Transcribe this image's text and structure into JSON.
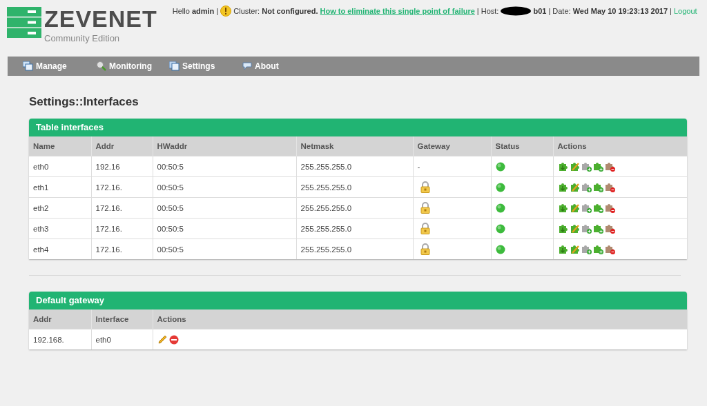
{
  "logo": {
    "name": "ZEVENET",
    "edition": "Community Edition"
  },
  "topbar": {
    "greeting": "Hello **admin** |",
    "cluster": "Cluster: **Not configured.**",
    "cluster_link": "How to eliminate this single point of failure",
    "host_label": "| Host:",
    "host": "b01",
    "date": "| Date: **Wed May 10 19:23:13 2017** |",
    "logout": "Logout"
  },
  "nav": [
    {
      "label": "Manage"
    },
    {
      "label": "Monitoring"
    },
    {
      "label": "Settings"
    },
    {
      "label": "About"
    }
  ],
  "page_title": "Settings::Interfaces",
  "interfaces": {
    "title": "Table interfaces",
    "columns": [
      "Name",
      "Addr",
      "HWaddr",
      "Netmask",
      "Gateway",
      "Status",
      "Actions"
    ],
    "rows": [
      {
        "name": "eth0",
        "addr": "192.16",
        "hwaddr": "00:50:5",
        "netmask": "255.255.255.0",
        "gateway": "-",
        "locked": false,
        "up": true
      },
      {
        "name": "eth1",
        "addr": "172.16.",
        "hwaddr": "00:50:5",
        "netmask": "255.255.255.0",
        "locked": true,
        "up": true
      },
      {
        "name": "eth2",
        "addr": "172.16.",
        "hwaddr": "00:50:5",
        "netmask": "255.255.255.0",
        "locked": true,
        "up": true
      },
      {
        "name": "eth3",
        "addr": "172.16.",
        "hwaddr": "00:50:5",
        "netmask": "255.255.255.0",
        "locked": true,
        "up": true
      },
      {
        "name": "eth4",
        "addr": "172.16.",
        "hwaddr": "00:50:5",
        "netmask": "255.255.255.0",
        "locked": true,
        "up": true
      }
    ]
  },
  "default_gateway": {
    "title": "Default gateway",
    "columns": [
      "Addr",
      "Interface",
      "Actions"
    ],
    "rows": [
      {
        "addr": "192.168.",
        "interface": "eth0"
      }
    ]
  }
}
